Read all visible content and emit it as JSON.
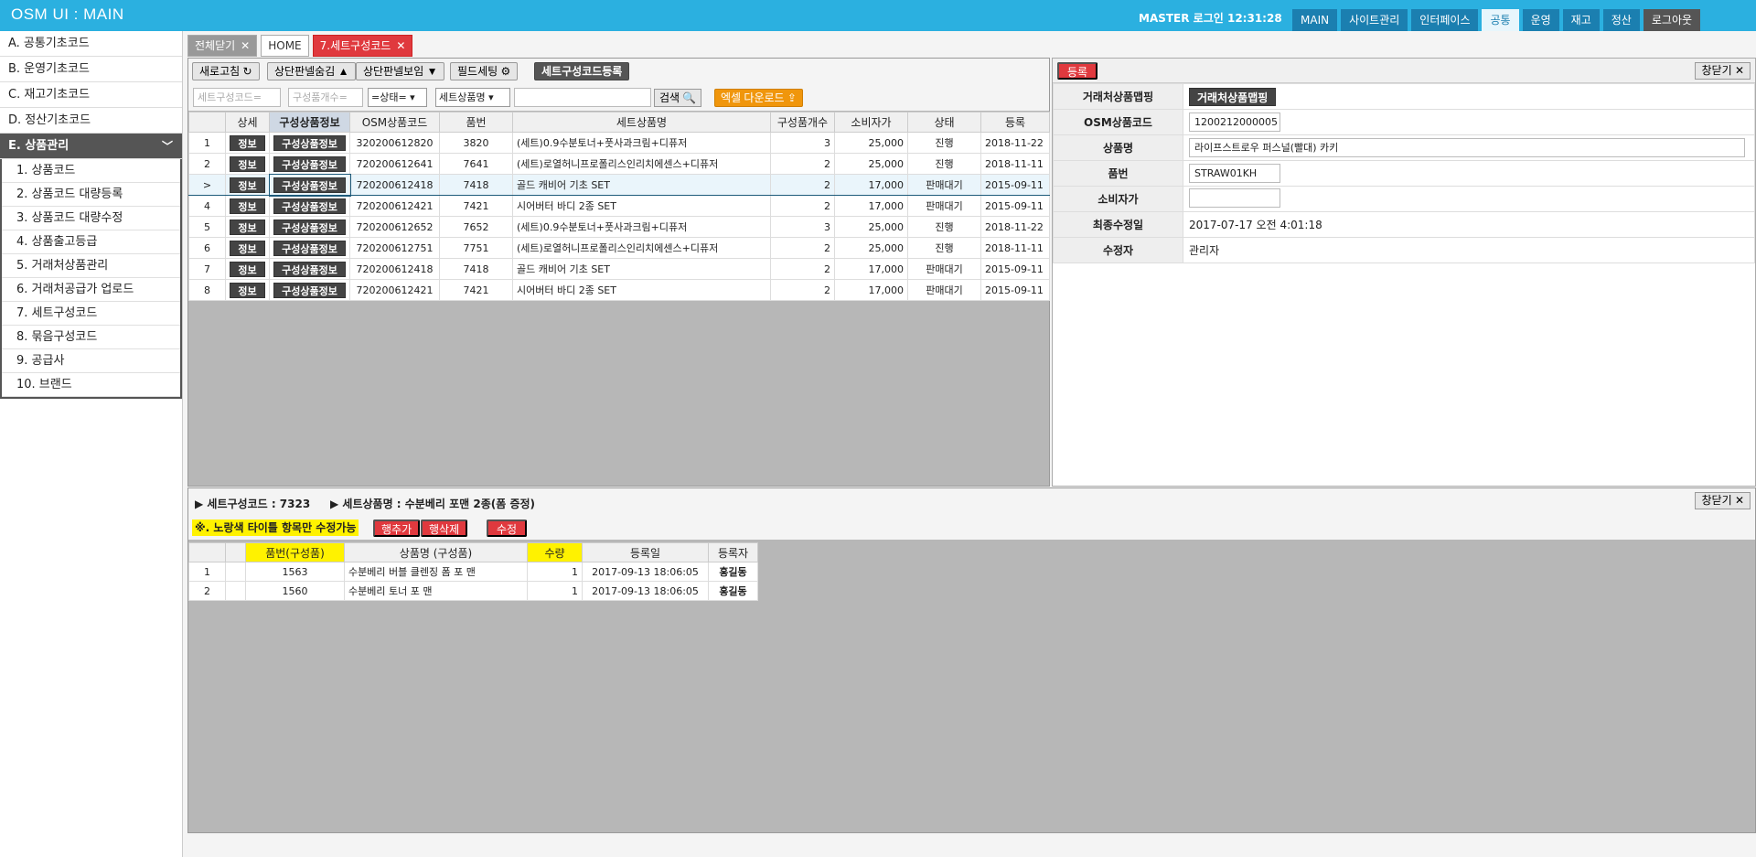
{
  "app": {
    "title": "OSM UI : MAIN",
    "login_info": "MASTER 로그인 12:31:28"
  },
  "topnav": [
    "MAIN",
    "사이트관리",
    "인터페이스",
    "공통",
    "운영",
    "재고",
    "정산",
    "로그아웃"
  ],
  "sidebar": {
    "groups": [
      "A. 공통기초코드",
      "B. 운영기초코드",
      "C. 재고기초코드",
      "D. 정산기초코드"
    ],
    "open_group": "E. 상품관리",
    "items": [
      "1. 상품코드",
      "2. 상품코드 대량등록",
      "3. 상품코드 대량수정",
      "4. 상품출고등급",
      "5. 거래처상품관리",
      "6. 거래처공급가 업로드",
      "7. 세트구성코드",
      "8. 묶음구성코드",
      "9. 공급사",
      "10. 브랜드"
    ]
  },
  "tabs": {
    "close_all": "전체닫기",
    "home": "HOME",
    "active": "7.세트구성코드",
    "close_glyph": "✕"
  },
  "toolbar": {
    "refresh": "새로고침 ↻",
    "hide_panel": "상단판넬숨김 ▲",
    "show_panel": "상단판넬보임 ▼",
    "field_setting": "필드세팅 ⚙",
    "register_set": "세트구성코드등록",
    "filter_set_code_ph": "세트구성코드=",
    "filter_count_ph": "구성품개수=",
    "filter_status": "=상태=",
    "filter_name_select": "세트상품명",
    "search": "검색 🔍",
    "excel": "엑셀 다운로드 ⇪"
  },
  "main_table": {
    "headers": [
      "",
      "상세",
      "구성상품정보",
      "OSM상품코드",
      "품번",
      "세트상품명",
      "구성품개수",
      "소비자가",
      "상태",
      "등록"
    ],
    "btn_info": "정보",
    "btn_components": "구성상품정보",
    "selected_marker": ">",
    "rows": [
      {
        "no": "1",
        "code": "320200612820",
        "item": "3820",
        "name": "(세트)0.9수분토너+풋사과크림+디퓨저",
        "count": "3",
        "price": "25,000",
        "status": "진행",
        "date": "2018-11-22"
      },
      {
        "no": "2",
        "code": "720200612641",
        "item": "7641",
        "name": "(세트)로열허니프로폴리스인리치에센스+디퓨저",
        "count": "2",
        "price": "25,000",
        "status": "진행",
        "date": "2018-11-11"
      },
      {
        "no": "3",
        "code": "720200612418",
        "item": "7418",
        "name": "골드 캐비어 기초 SET",
        "count": "2",
        "price": "17,000",
        "status": "판매대기",
        "date": "2015-09-11"
      },
      {
        "no": "4",
        "code": "720200612421",
        "item": "7421",
        "name": "시어버터 바디 2종 SET",
        "count": "2",
        "price": "17,000",
        "status": "판매대기",
        "date": "2015-09-11"
      },
      {
        "no": "5",
        "code": "720200612652",
        "item": "7652",
        "name": "(세트)0.9수분토너+풋사과크림+디퓨저",
        "count": "3",
        "price": "25,000",
        "status": "진행",
        "date": "2018-11-22"
      },
      {
        "no": "6",
        "code": "720200612751",
        "item": "7751",
        "name": "(세트)로열허니프로폴리스인리치에센스+디퓨저",
        "count": "2",
        "price": "25,000",
        "status": "진행",
        "date": "2018-11-11"
      },
      {
        "no": "7",
        "code": "720200612418",
        "item": "7418",
        "name": "골드 캐비어 기초 SET",
        "count": "2",
        "price": "17,000",
        "status": "판매대기",
        "date": "2015-09-11"
      },
      {
        "no": "8",
        "code": "720200612421",
        "item": "7421",
        "name": "시어버터 바디 2종 SET",
        "count": "2",
        "price": "17,000",
        "status": "판매대기",
        "date": "2015-09-11"
      }
    ]
  },
  "detail": {
    "register_btn": "등록",
    "close_btn": "창닫기 ✕",
    "fields": [
      {
        "label": "거래처상품맵핑",
        "value": "거래처상품맵핑",
        "kind": "button"
      },
      {
        "label": "OSM상품코드",
        "value": "1200212000005",
        "kind": "input-short"
      },
      {
        "label": "상품명",
        "value": "라이프스트로우 퍼스널(빨대) 카키",
        "kind": "input-long"
      },
      {
        "label": "품번",
        "value": "STRAW01KH",
        "kind": "input-short"
      },
      {
        "label": "소비자가",
        "value": "",
        "kind": "input-short"
      },
      {
        "label": "최종수정일",
        "value": "2017-07-17 오전 4:01:18",
        "kind": "text"
      },
      {
        "label": "수정자",
        "value": "관리자",
        "kind": "text"
      }
    ]
  },
  "bottom": {
    "set_code": "▶ 세트구성코드 : 7323",
    "set_name": "▶ 세트상품명 : 수분베리 포맨 2종(폼 증정)",
    "close_btn": "창닫기 ✕",
    "note": "※. 노랑색 타이틀 항목만 수정가능",
    "add_row": "행추가",
    "delete_row": "행삭제",
    "edit": "수정",
    "headers": [
      "",
      "",
      "품번(구성품)",
      "상품명 (구성품)",
      "수량",
      "등록일",
      "등록자"
    ],
    "rows": [
      {
        "no": "1",
        "item": "1563",
        "name": "수분베리 버블 클렌징 폼 포 맨",
        "qty": "1",
        "date": "2017-09-13 18:06:05",
        "user": "홍길동"
      },
      {
        "no": "2",
        "item": "1560",
        "name": "수분베리 토너 포 맨",
        "qty": "1",
        "date": "2017-09-13 18:06:05",
        "user": "홍길동"
      }
    ]
  }
}
